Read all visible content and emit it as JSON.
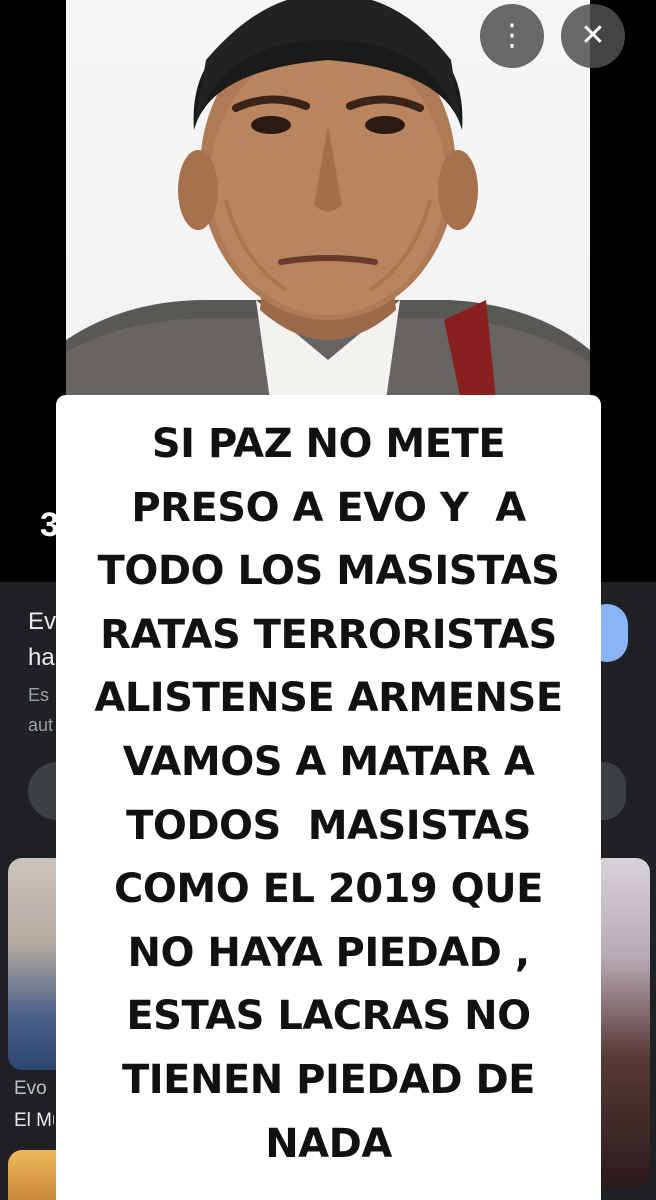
{
  "viewer": {
    "more_icon_glyph": "⋮",
    "close_icon_glyph": "✕",
    "side_glyph": "3"
  },
  "results": {
    "title_lines": [
      "Evo",
      "ha"
    ],
    "snippet_lines": [
      "Es",
      "aut"
    ],
    "caption_1": "Evo",
    "caption_2": "El Mu"
  },
  "overlay": {
    "lines": [
      "SI PAZ NO METE",
      "PRESO A EVO Y  A",
      "TODO LOS MASISTAS",
      "RATAS TERRORISTAS",
      "ALISTENSE ARMENSE",
      "VAMOS A MATAR A",
      "TODOS  MASISTAS",
      "COMO EL 2019 QUE",
      "NO HAYA PIEDAD ,",
      "ESTAS LACRAS NO",
      "TIENEN PIEDAD DE",
      "NADA"
    ]
  },
  "colors": {
    "background": "#000000",
    "results_background": "#1f2124",
    "card": "#ffffff",
    "overlay_text": "#111111",
    "accent_blue": "#8ab4f8"
  }
}
